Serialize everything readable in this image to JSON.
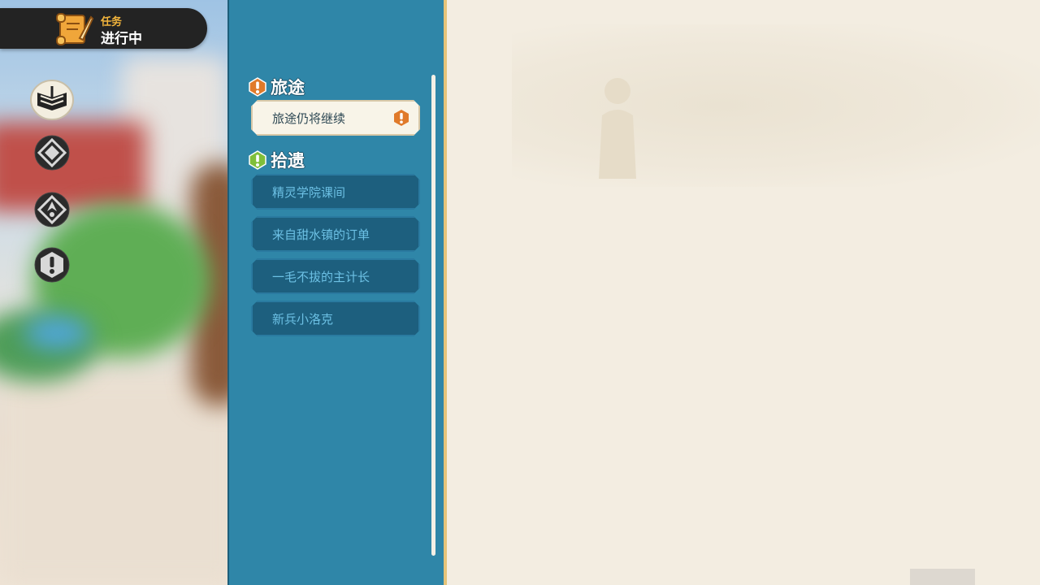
{
  "header": {
    "subtitle": "任务",
    "title": "进行中"
  },
  "side_nav": [
    {
      "icon": "open-book-icon",
      "state": "selected"
    },
    {
      "icon": "compass-diamond-icon",
      "state": "normal"
    },
    {
      "icon": "compass-arrow-icon",
      "state": "normal"
    },
    {
      "icon": "exclamation-icon",
      "state": "normal"
    }
  ],
  "quest_list": {
    "categories": [
      {
        "label": "旅途",
        "badge_color": "#e07a2a",
        "quests": [
          {
            "label": "旅途仍将继续",
            "selected": true,
            "alert": true
          }
        ]
      },
      {
        "label": "拾遗",
        "badge_color": "#7fbf3a",
        "quests": [
          {
            "label": "精灵学院课间",
            "selected": false
          },
          {
            "label": "来自甜水镇的订单",
            "selected": false
          },
          {
            "label": "一毛不拔的主计长",
            "selected": false
          },
          {
            "label": "新兵小洛克",
            "selected": false
          }
        ]
      }
    ]
  },
  "colors": {
    "panel": "#2f86a8",
    "parchment": "#f3ede1",
    "header_bg": "#232323",
    "accent_gold": "#f3b53c"
  }
}
